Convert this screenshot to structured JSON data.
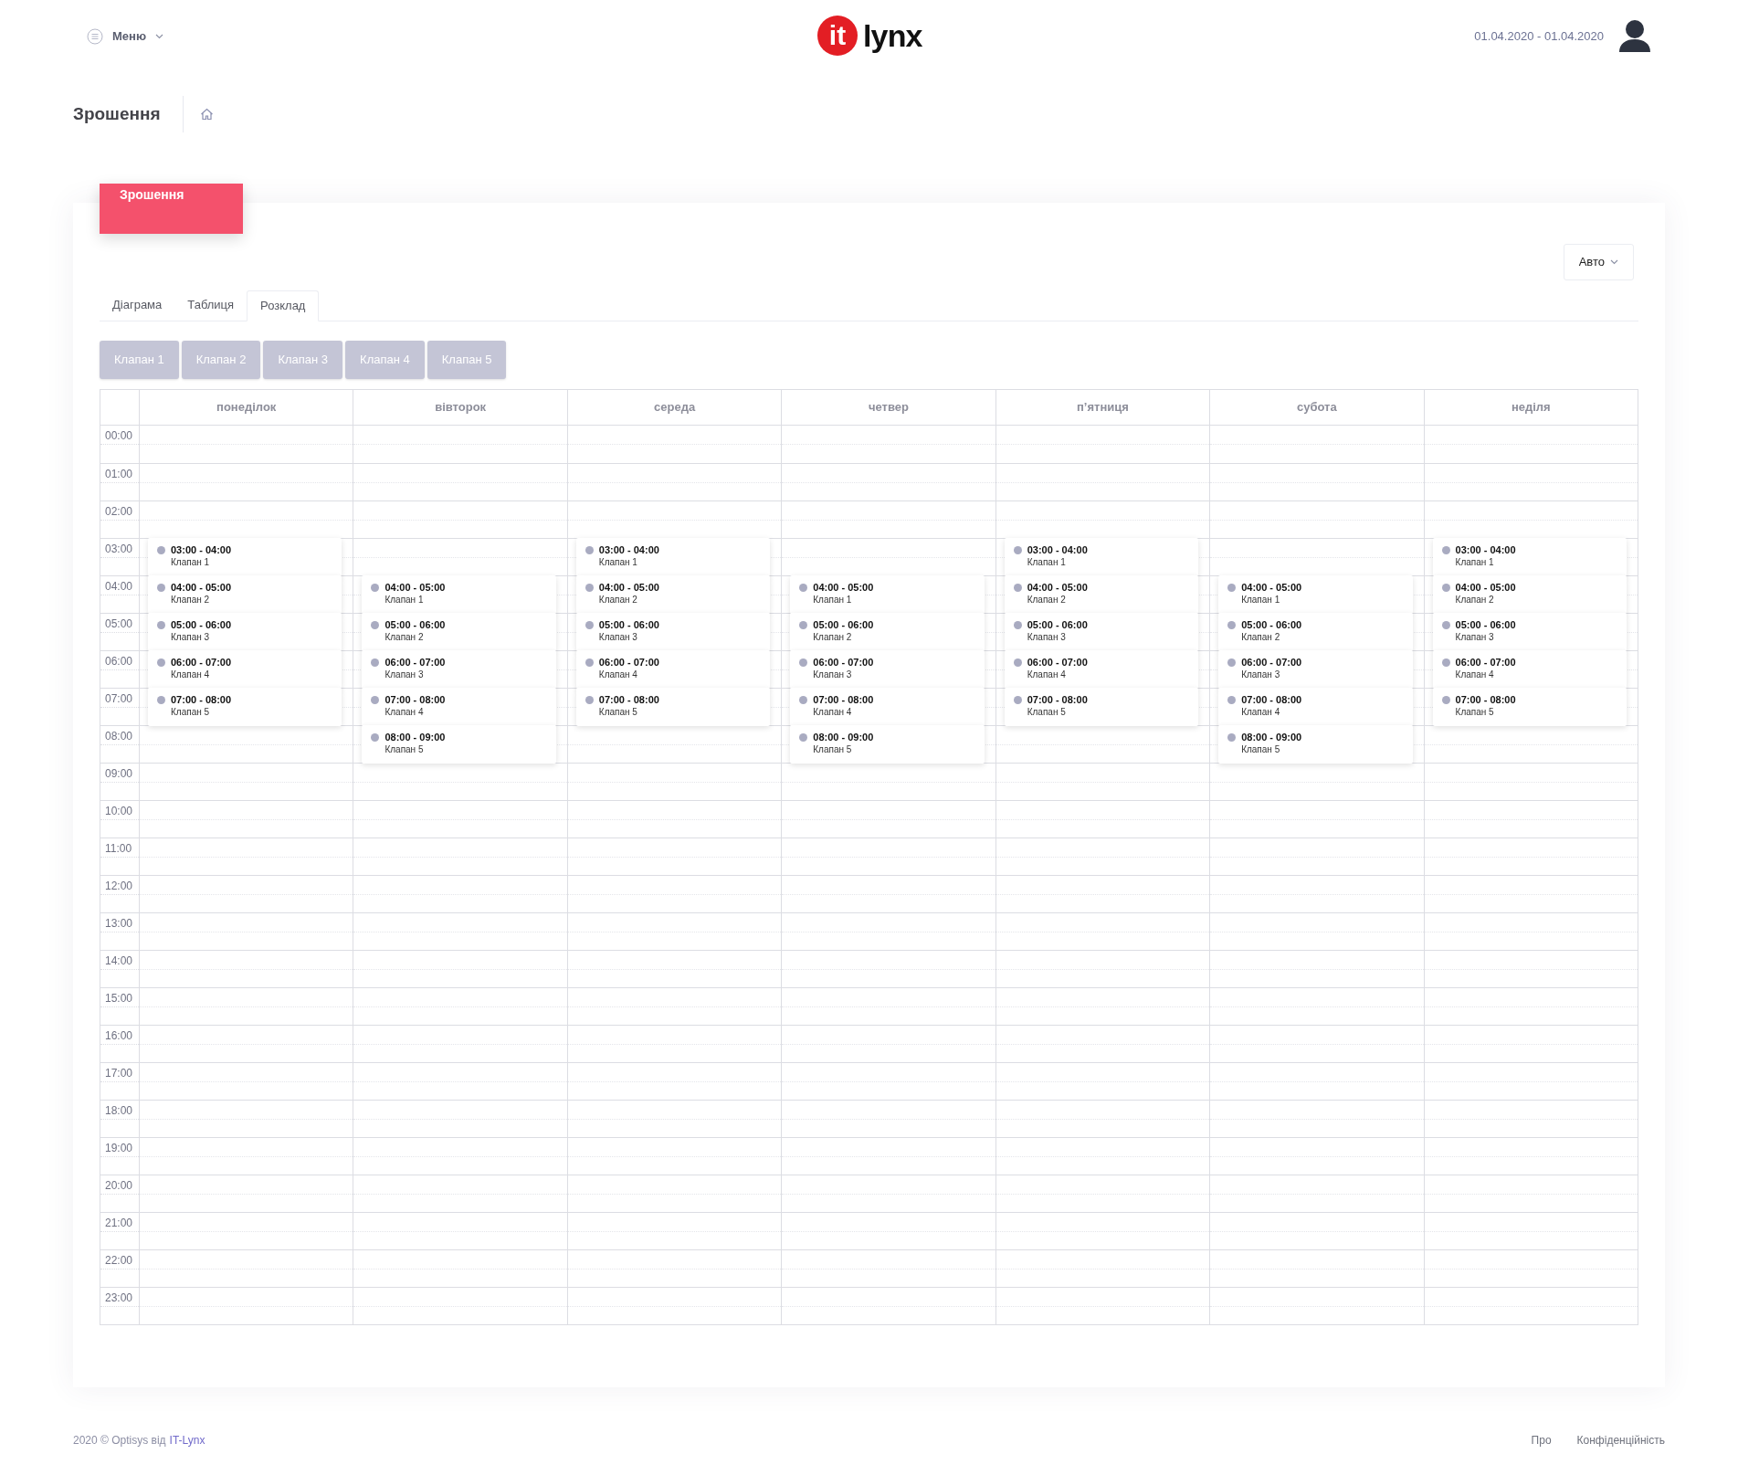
{
  "header": {
    "menu_label": "Меню",
    "logo": {
      "mark": "it",
      "word": "lynx"
    },
    "date_range": "01.04.2020 - 01.04.2020"
  },
  "page_title": "Зрошення",
  "card": {
    "title": "Зрошення",
    "mode_select": "Авто",
    "tabs": [
      {
        "label": "Діаграма",
        "selected": false
      },
      {
        "label": "Таблиця",
        "selected": false
      },
      {
        "label": "Розклад",
        "selected": true
      }
    ],
    "valve_buttons": [
      "Клапан 1",
      "Клапан 2",
      "Клапан 3",
      "Клапан 4",
      "Клапан 5"
    ],
    "schedule": {
      "days": [
        "понеділок",
        "вівторок",
        "середа",
        "четвер",
        "п’ятниця",
        "субота",
        "неділя"
      ],
      "rows": [
        {
          "time": "00:00"
        },
        {
          "time": "01:00"
        },
        {
          "time": "02:00"
        },
        {
          "time": "03:00",
          "cells": [
            {
              "time": "03:00 - 04:00",
              "valve": "Клапан 1"
            },
            null,
            {
              "time": "03:00 - 04:00",
              "valve": "Клапан 1"
            },
            null,
            {
              "time": "03:00 - 04:00",
              "valve": "Клапан 1"
            },
            null,
            {
              "time": "03:00 - 04:00",
              "valve": "Клапан 1"
            }
          ]
        },
        {
          "time": "04:00",
          "cells": [
            {
              "time": "04:00 - 05:00",
              "valve": "Клапан 2"
            },
            {
              "time": "04:00 - 05:00",
              "valve": "Клапан 1"
            },
            {
              "time": "04:00 - 05:00",
              "valve": "Клапан 2"
            },
            {
              "time": "04:00 - 05:00",
              "valve": "Клапан 1"
            },
            {
              "time": "04:00 - 05:00",
              "valve": "Клапан 2"
            },
            {
              "time": "04:00 - 05:00",
              "valve": "Клапан 1"
            },
            {
              "time": "04:00 - 05:00",
              "valve": "Клапан 2"
            }
          ]
        },
        {
          "time": "05:00",
          "cells": [
            {
              "time": "05:00 - 06:00",
              "valve": "Клапан 3"
            },
            {
              "time": "05:00 - 06:00",
              "valve": "Клапан 2"
            },
            {
              "time": "05:00 - 06:00",
              "valve": "Клапан 3"
            },
            {
              "time": "05:00 - 06:00",
              "valve": "Клапан 2"
            },
            {
              "time": "05:00 - 06:00",
              "valve": "Клапан 3"
            },
            {
              "time": "05:00 - 06:00",
              "valve": "Клапан 2"
            },
            {
              "time": "05:00 - 06:00",
              "valve": "Клапан 3"
            }
          ]
        },
        {
          "time": "06:00",
          "cells": [
            {
              "time": "06:00 - 07:00",
              "valve": "Клапан 4"
            },
            {
              "time": "06:00 - 07:00",
              "valve": "Клапан 3"
            },
            {
              "time": "06:00 - 07:00",
              "valve": "Клапан 4"
            },
            {
              "time": "06:00 - 07:00",
              "valve": "Клапан 3"
            },
            {
              "time": "06:00 - 07:00",
              "valve": "Клапан 4"
            },
            {
              "time": "06:00 - 07:00",
              "valve": "Клапан 3"
            },
            {
              "time": "06:00 - 07:00",
              "valve": "Клапан 4"
            }
          ]
        },
        {
          "time": "07:00",
          "cells": [
            {
              "time": "07:00 - 08:00",
              "valve": "Клапан 5"
            },
            {
              "time": "07:00 - 08:00",
              "valve": "Клапан 4"
            },
            {
              "time": "07:00 - 08:00",
              "valve": "Клапан 5"
            },
            {
              "time": "07:00 - 08:00",
              "valve": "Клапан 4"
            },
            {
              "time": "07:00 - 08:00",
              "valve": "Клапан 5"
            },
            {
              "time": "07:00 - 08:00",
              "valve": "Клапан 4"
            },
            {
              "time": "07:00 - 08:00",
              "valve": "Клапан 5"
            }
          ]
        },
        {
          "time": "08:00",
          "cells": [
            null,
            {
              "time": "08:00 - 09:00",
              "valve": "Клапан 5"
            },
            null,
            {
              "time": "08:00 - 09:00",
              "valve": "Клапан 5"
            },
            null,
            {
              "time": "08:00 - 09:00",
              "valve": "Клапан 5"
            },
            null
          ]
        },
        {
          "time": "09:00"
        },
        {
          "time": "10:00"
        },
        {
          "time": "11:00"
        },
        {
          "time": "12:00"
        },
        {
          "time": "13:00"
        },
        {
          "time": "14:00"
        },
        {
          "time": "15:00"
        },
        {
          "time": "16:00"
        },
        {
          "time": "17:00"
        },
        {
          "time": "18:00"
        },
        {
          "time": "19:00"
        },
        {
          "time": "20:00"
        },
        {
          "time": "21:00"
        },
        {
          "time": "22:00"
        },
        {
          "time": "23:00"
        }
      ]
    }
  },
  "footer": {
    "copyright": "2020 © Optisys від",
    "company_link": "IT-Lynx",
    "links": [
      "Про",
      "Конфіденційність"
    ]
  }
}
